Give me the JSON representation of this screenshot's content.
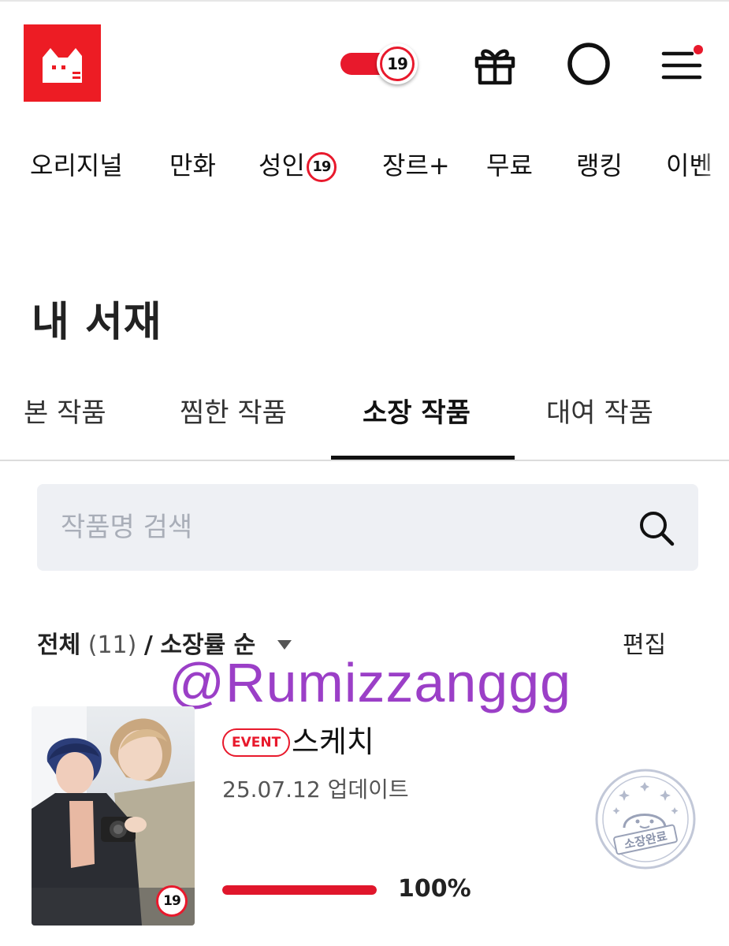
{
  "header": {
    "logo_name": "cat-logo",
    "adult_toggle_label": "19",
    "icons": [
      "gift-icon",
      "circle-icon",
      "menu-icon"
    ],
    "brand_color": "#ed1c24"
  },
  "nav": {
    "items": [
      {
        "label": "오리지널"
      },
      {
        "label": "만화"
      },
      {
        "label": "성인",
        "badge": "19"
      },
      {
        "label": "장르+"
      },
      {
        "label": "무료"
      },
      {
        "label": "랭킹"
      },
      {
        "label": "이벤"
      }
    ]
  },
  "page": {
    "title": "내 서재"
  },
  "library_tabs": {
    "items": [
      {
        "label": "본 작품"
      },
      {
        "label": "찜한 작품"
      },
      {
        "label": "소장 작품",
        "active": true
      },
      {
        "label": "대여 작품"
      }
    ]
  },
  "search": {
    "placeholder": "작품명 검색",
    "value": ""
  },
  "filter": {
    "scope": "전체",
    "count": "(11)",
    "separator": "/",
    "sort": "소장률 순",
    "edit_label": "편집"
  },
  "watermark": "@Rumizzanggg",
  "books": [
    {
      "badge": "EVENT",
      "title": "스케치",
      "updated": "25.07.12 업데이트",
      "progress": 1.0,
      "progress_text": "100%",
      "cover_badge": "19",
      "stamp_text": "소장완료"
    }
  ],
  "colors": {
    "accent": "#e8192c",
    "search_bg": "#eef0f4",
    "watermark": "#9b3fc7"
  }
}
